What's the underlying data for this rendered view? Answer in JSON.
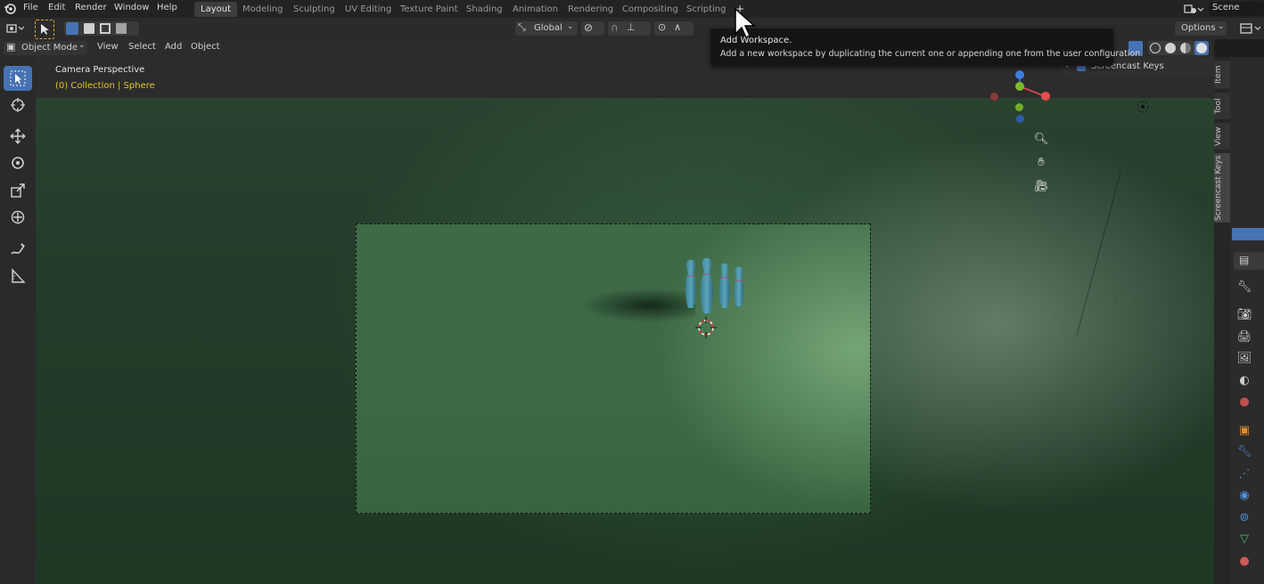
{
  "topbar": {
    "menus": [
      "File",
      "Edit",
      "Render",
      "Window",
      "Help"
    ],
    "workspaces": [
      "Layout",
      "Modeling",
      "Sculpting",
      "UV Editing",
      "Texture Paint",
      "Shading",
      "Animation",
      "Rendering",
      "Compositing",
      "Scripting"
    ],
    "add_tab": "+",
    "scene_label": "Scene"
  },
  "header": {
    "mode": "Object Mode",
    "menus": [
      "View",
      "Select",
      "Add",
      "Object"
    ],
    "transform_orientation": "Global",
    "options_label": "Options"
  },
  "viewport": {
    "view_name": "Camera Perspective",
    "collection_info": "(0) Collection | Sphere"
  },
  "tooltip": {
    "title": "Add Workspace.",
    "description": "Add a new workspace by duplicating the current one or appending one from the user configuration."
  },
  "outliner": {
    "item": "Screencast Keys"
  },
  "sidebar_tabs": [
    "Item",
    "Tool",
    "View",
    "Screencast Keys"
  ],
  "gizmo": {
    "z": "Z",
    "y": "Y",
    "x": "X"
  },
  "colors": {
    "accent": "#4772b3",
    "collection_text": "#e3c32a",
    "axis_x": "#e84c4c",
    "axis_y": "#7bb92f",
    "axis_z": "#3f7fe0"
  }
}
